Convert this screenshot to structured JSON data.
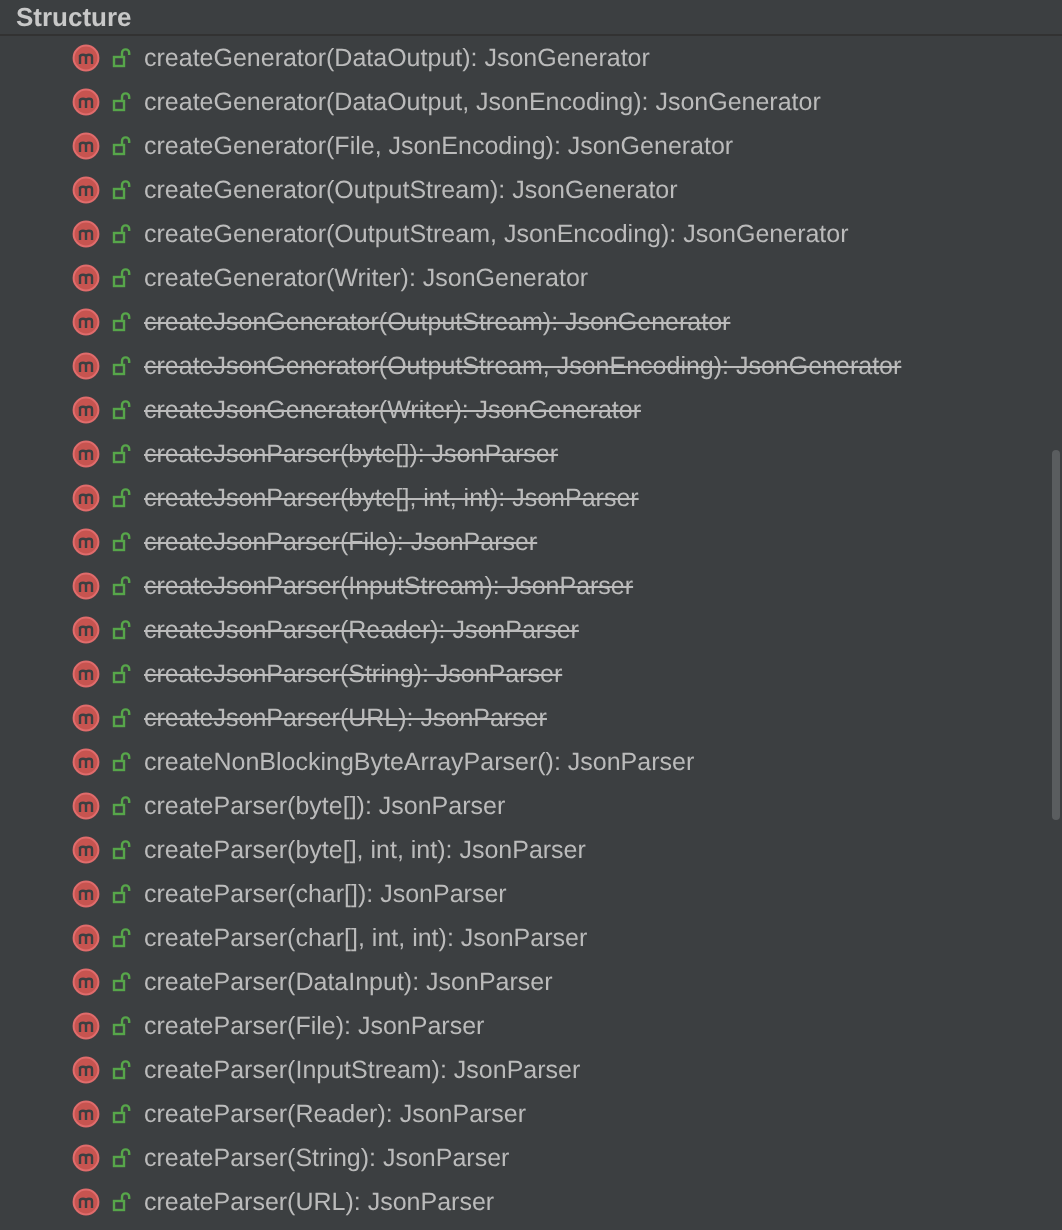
{
  "panel": {
    "title": "Structure"
  },
  "members": [
    {
      "signature": "createGenerator(DataOutput): JsonGenerator",
      "deprecated": false
    },
    {
      "signature": "createGenerator(DataOutput, JsonEncoding): JsonGenerator",
      "deprecated": false
    },
    {
      "signature": "createGenerator(File, JsonEncoding): JsonGenerator",
      "deprecated": false
    },
    {
      "signature": "createGenerator(OutputStream): JsonGenerator",
      "deprecated": false
    },
    {
      "signature": "createGenerator(OutputStream, JsonEncoding): JsonGenerator",
      "deprecated": false
    },
    {
      "signature": "createGenerator(Writer): JsonGenerator",
      "deprecated": false
    },
    {
      "signature": "createJsonGenerator(OutputStream): JsonGenerator",
      "deprecated": true
    },
    {
      "signature": "createJsonGenerator(OutputStream, JsonEncoding): JsonGenerator",
      "deprecated": true
    },
    {
      "signature": "createJsonGenerator(Writer): JsonGenerator",
      "deprecated": true
    },
    {
      "signature": "createJsonParser(byte[]): JsonParser",
      "deprecated": true
    },
    {
      "signature": "createJsonParser(byte[], int, int): JsonParser",
      "deprecated": true
    },
    {
      "signature": "createJsonParser(File): JsonParser",
      "deprecated": true
    },
    {
      "signature": "createJsonParser(InputStream): JsonParser",
      "deprecated": true
    },
    {
      "signature": "createJsonParser(Reader): JsonParser",
      "deprecated": true
    },
    {
      "signature": "createJsonParser(String): JsonParser",
      "deprecated": true
    },
    {
      "signature": "createJsonParser(URL): JsonParser",
      "deprecated": true
    },
    {
      "signature": "createNonBlockingByteArrayParser(): JsonParser",
      "deprecated": false
    },
    {
      "signature": "createParser(byte[]): JsonParser",
      "deprecated": false
    },
    {
      "signature": "createParser(byte[], int, int): JsonParser",
      "deprecated": false
    },
    {
      "signature": "createParser(char[]): JsonParser",
      "deprecated": false
    },
    {
      "signature": "createParser(char[], int, int): JsonParser",
      "deprecated": false
    },
    {
      "signature": "createParser(DataInput): JsonParser",
      "deprecated": false
    },
    {
      "signature": "createParser(File): JsonParser",
      "deprecated": false
    },
    {
      "signature": "createParser(InputStream): JsonParser",
      "deprecated": false
    },
    {
      "signature": "createParser(Reader): JsonParser",
      "deprecated": false
    },
    {
      "signature": "createParser(String): JsonParser",
      "deprecated": false
    },
    {
      "signature": "createParser(URL): JsonParser",
      "deprecated": false
    }
  ]
}
